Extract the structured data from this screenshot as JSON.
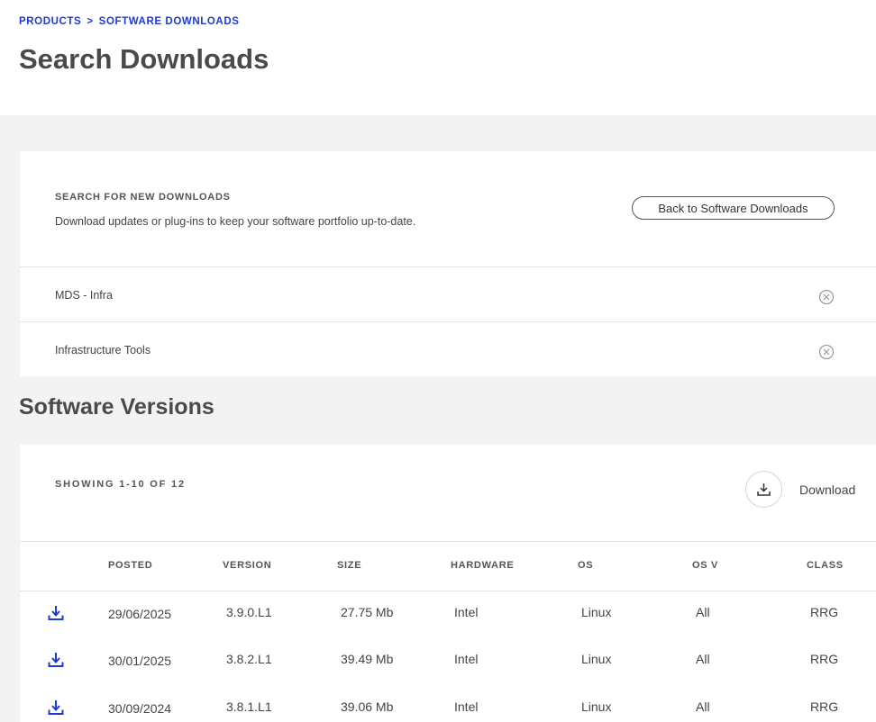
{
  "breadcrumb": {
    "products": "PRODUCTS",
    "separator": ">",
    "current": "SOFTWARE DOWNLOADS"
  },
  "page_title": "Search Downloads",
  "search": {
    "eyebrow": "SEARCH FOR NEW DOWNLOADS",
    "description": "Download updates or plug-ins to keep your software portfolio up-to-date.",
    "back_button": "Back to Software Downloads"
  },
  "filters": [
    {
      "label": "MDS - Infra"
    },
    {
      "label": "Infrastructure Tools"
    }
  ],
  "versions_title": "Software Versions",
  "results": {
    "showing": "SHOWING 1-10 OF 12",
    "download_label": "Download"
  },
  "table": {
    "columns": [
      "POSTED",
      "VERSION",
      "SIZE",
      "HARDWARE",
      "OS",
      "OS V",
      "CLASS"
    ],
    "rows": [
      {
        "posted": "29/06/2025",
        "version": "3.9.0.L1",
        "size": "27.75 Mb",
        "hardware": "Intel",
        "os": "Linux",
        "os_v": "All",
        "class": "RRG"
      },
      {
        "posted": "30/01/2025",
        "version": "3.8.2.L1",
        "size": "39.49 Mb",
        "hardware": "Intel",
        "os": "Linux",
        "os_v": "All",
        "class": "RRG"
      },
      {
        "posted": "30/09/2024",
        "version": "3.8.1.L1",
        "size": "39.06 Mb",
        "hardware": "Intel",
        "os": "Linux",
        "os_v": "All",
        "class": "RRG"
      }
    ]
  },
  "colors": {
    "link_blue": "#1f3ad1",
    "heading_gray": "#4a4a4a",
    "background_gray": "#f3f3f3"
  },
  "icons": {
    "clear": "close-circle-icon",
    "download": "download-icon"
  }
}
